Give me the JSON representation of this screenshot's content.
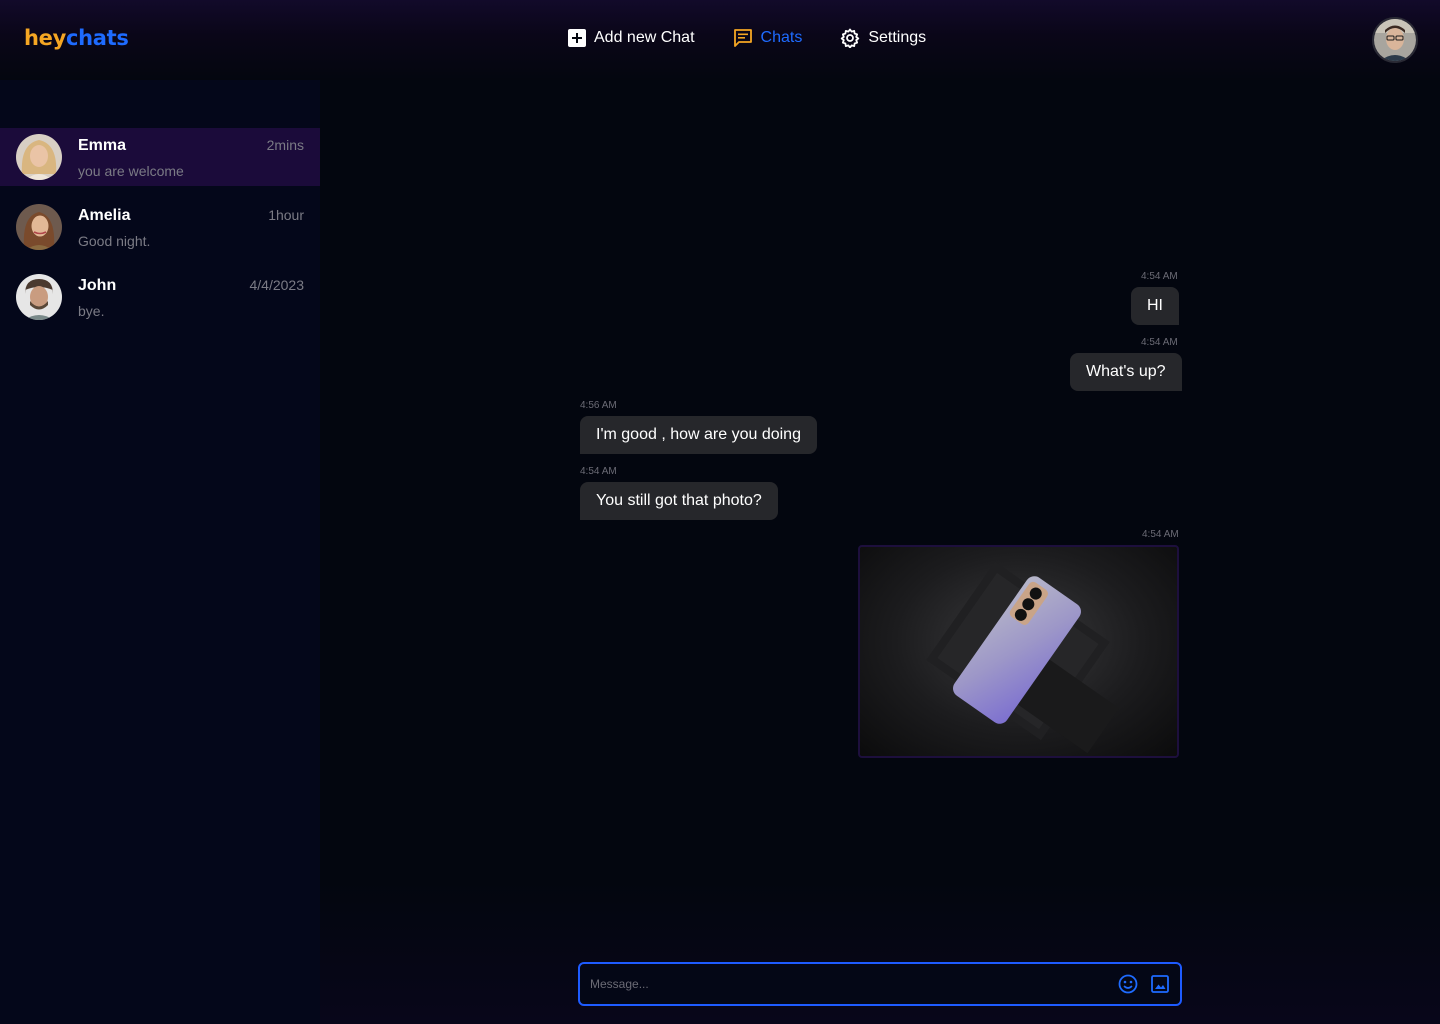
{
  "header": {
    "logo": {
      "part1": "hey",
      "part2": "chats"
    },
    "nav": [
      {
        "label": "Add new Chat",
        "icon": "plus-square-icon",
        "active": false
      },
      {
        "label": "Chats",
        "icon": "chat-icon",
        "active": true
      },
      {
        "label": "Settings",
        "icon": "gear-icon",
        "active": false
      }
    ],
    "profile_icon": "user-avatar"
  },
  "sidebar": {
    "chats": [
      {
        "name": "Emma",
        "preview": "you are welcome",
        "time": "2mins",
        "active": true
      },
      {
        "name": "Amelia",
        "preview": "Good night.",
        "time": "1hour",
        "active": false
      },
      {
        "name": "John",
        "preview": "bye.",
        "time": "4/4/2023",
        "active": false
      }
    ]
  },
  "conversation": {
    "messages": [
      {
        "direction": "out",
        "time": "4:54 AM",
        "text": "HI"
      },
      {
        "direction": "out",
        "time": "4:54 AM",
        "text": "What's up?"
      },
      {
        "direction": "in",
        "time": "4:56 AM",
        "text": "I'm good , how are you doing"
      },
      {
        "direction": "in",
        "time": "4:54 AM",
        "text": "You still got that photo?"
      },
      {
        "direction": "out",
        "time": "4:54 AM",
        "type": "image",
        "icon": "phone-photo"
      }
    ]
  },
  "composer": {
    "placeholder": "Message...",
    "value": "",
    "emoji_icon": "emoji-icon",
    "image_icon": "image-icon"
  },
  "colors": {
    "accent": "#1e6bff",
    "logo_orange": "#f5a623",
    "active_row": "#1b0b3a",
    "bubble": "#26272b"
  }
}
